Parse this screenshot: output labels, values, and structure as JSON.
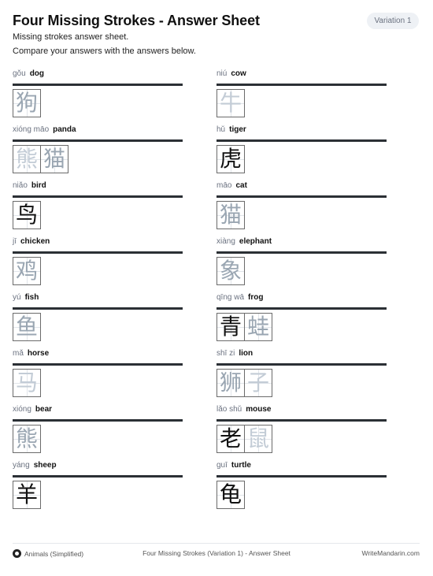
{
  "header": {
    "title": "Four Missing Strokes - Answer Sheet",
    "badge": "Variation 1",
    "subtitle1": "Missing strokes answer sheet.",
    "subtitle2": "Compare your answers with the answers below."
  },
  "left_column": [
    {
      "pinyin": "gǒu",
      "english": "dog",
      "chars": [
        {
          "c": "狗",
          "style": "partial"
        }
      ]
    },
    {
      "pinyin": "xióng māo",
      "english": "panda",
      "chars": [
        {
          "c": "熊",
          "style": "ghost"
        },
        {
          "c": "猫",
          "style": "partial"
        }
      ]
    },
    {
      "pinyin": "niǎo",
      "english": "bird",
      "chars": [
        {
          "c": "鸟",
          "style": "full"
        }
      ]
    },
    {
      "pinyin": "jī",
      "english": "chicken",
      "chars": [
        {
          "c": "鸡",
          "style": "partial"
        }
      ]
    },
    {
      "pinyin": "yú",
      "english": "fish",
      "chars": [
        {
          "c": "鱼",
          "style": "partial"
        }
      ]
    },
    {
      "pinyin": "mǎ",
      "english": "horse",
      "chars": [
        {
          "c": "马",
          "style": "ghost"
        }
      ]
    },
    {
      "pinyin": "xióng",
      "english": "bear",
      "chars": [
        {
          "c": "熊",
          "style": "partial"
        }
      ]
    },
    {
      "pinyin": "yáng",
      "english": "sheep",
      "chars": [
        {
          "c": "羊",
          "style": "full"
        }
      ]
    }
  ],
  "right_column": [
    {
      "pinyin": "niú",
      "english": "cow",
      "chars": [
        {
          "c": "牛",
          "style": "ghost"
        }
      ]
    },
    {
      "pinyin": "hǔ",
      "english": "tiger",
      "chars": [
        {
          "c": "虎",
          "style": "full"
        }
      ]
    },
    {
      "pinyin": "māo",
      "english": "cat",
      "chars": [
        {
          "c": "猫",
          "style": "partial"
        }
      ]
    },
    {
      "pinyin": "xiàng",
      "english": "elephant",
      "chars": [
        {
          "c": "象",
          "style": "partial"
        }
      ]
    },
    {
      "pinyin": "qīng wā",
      "english": "frog",
      "chars": [
        {
          "c": "青",
          "style": "full"
        },
        {
          "c": "蛙",
          "style": "partial"
        }
      ]
    },
    {
      "pinyin": "shī zi",
      "english": "lion",
      "chars": [
        {
          "c": "狮",
          "style": "partial"
        },
        {
          "c": "子",
          "style": "ghost"
        }
      ]
    },
    {
      "pinyin": "lǎo shǔ",
      "english": "mouse",
      "chars": [
        {
          "c": "老",
          "style": "full"
        },
        {
          "c": "鼠",
          "style": "ghost"
        }
      ]
    },
    {
      "pinyin": "guī",
      "english": "turtle",
      "chars": [
        {
          "c": "龟",
          "style": "full"
        }
      ]
    }
  ],
  "footer": {
    "icon": "bear-icon",
    "left": "Animals (Simplified)",
    "center": "Four Missing Strokes (Variation 1) - Answer Sheet",
    "right": "WriteMandarin.com"
  }
}
